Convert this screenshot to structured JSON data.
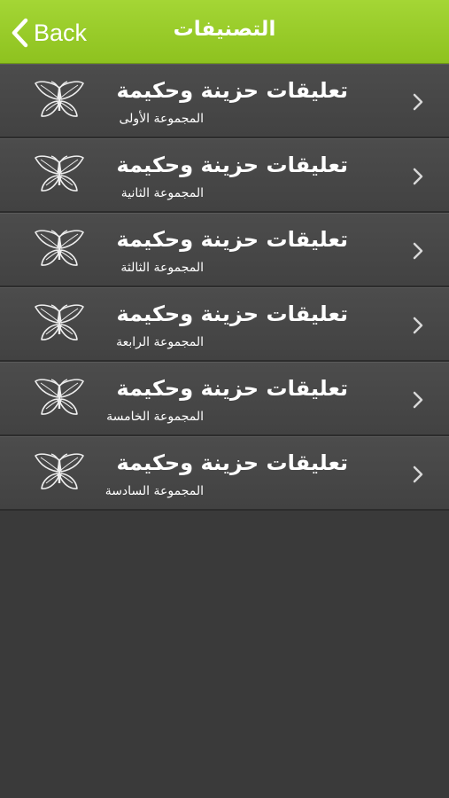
{
  "navbar": {
    "back_label": "Back",
    "title": "التصنيفات",
    "bg_color": "#96c825"
  },
  "list": {
    "chevron_icon": "chevron-right-icon",
    "thumb_icon": "butterfly-icon",
    "items": [
      {
        "title": "تعليقات حزينة وحكيمة",
        "subtitle": "المجموعة الأولى"
      },
      {
        "title": "تعليقات حزينة وحكيمة",
        "subtitle": "المجموعة الثانية"
      },
      {
        "title": "تعليقات حزينة وحكيمة",
        "subtitle": "المجموعة الثالثة"
      },
      {
        "title": "تعليقات حزينة وحكيمة",
        "subtitle": "المجموعة الرابعة"
      },
      {
        "title": "تعليقات حزينة وحكيمة",
        "subtitle": "المجموعة الخامسة"
      },
      {
        "title": "تعليقات حزينة وحكيمة",
        "subtitle": "المجموعة السادسة"
      }
    ]
  }
}
